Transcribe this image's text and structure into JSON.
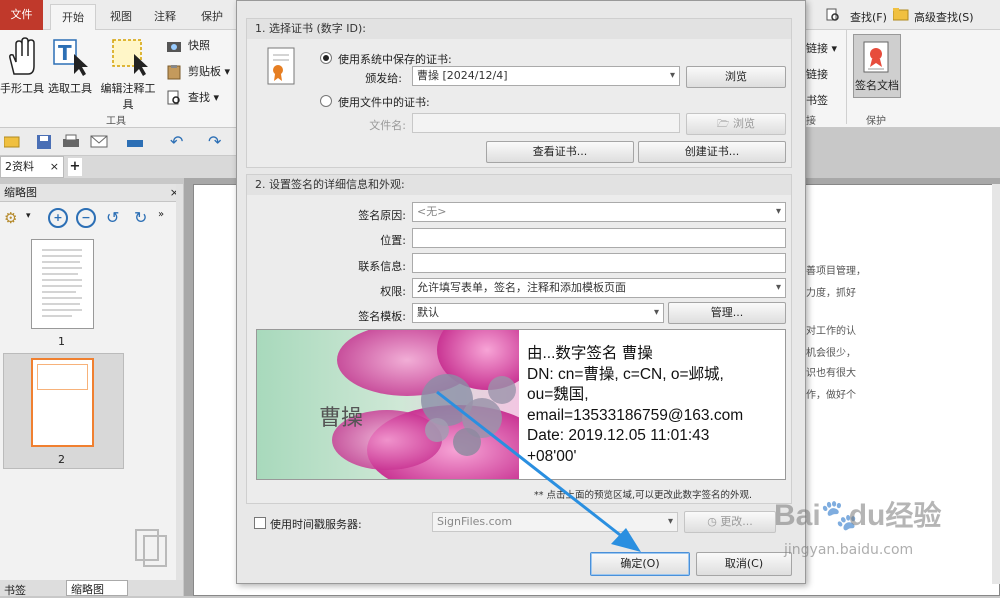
{
  "ribbon": {
    "tabs": [
      "文件",
      "开始",
      "视图",
      "注释",
      "保护"
    ],
    "right_search": "查找(F)",
    "right_advanced_search": "高级查找(S)",
    "big_buttons": [
      "手形工具",
      "选取工具",
      "编辑注释工具"
    ],
    "small_buttons": [
      "快照",
      "剪贴板",
      "查找"
    ],
    "group_tools": "工具",
    "right_items": [
      "链接",
      "链接",
      "书签"
    ],
    "sign_doc": "签名文档",
    "group_protect": "保护",
    "group_partial": "接"
  },
  "document_tab": "2资料",
  "left_pane": {
    "title": "缩略图",
    "pages": [
      "1",
      "2"
    ],
    "bottom_tabs": [
      "书签",
      "缩略图"
    ]
  },
  "doc_text": [
    "完善项目管理，",
    "查力度，抓好",
    "是对工作的认",
    "的机会很少，",
    "知识也有很大",
    "工作，做好个"
  ],
  "dialog": {
    "section1": {
      "title": "1. 选择证书 (数字 ID):",
      "radio_system": "使用系统中保存的证书:",
      "issued_to_label": "颁发给:",
      "issued_to_value": "曹操 [2024/12/4]",
      "browse": "浏览",
      "radio_file": "使用文件中的证书:",
      "filename_label": "文件名:",
      "filename_value": "",
      "browse_disabled": "浏览",
      "view_cert": "查看证书...",
      "create_cert": "创建证书..."
    },
    "section2": {
      "title": "2. 设置签名的详细信息和外观:",
      "reason_label": "签名原因:",
      "reason_value": "<无>",
      "location_label": "位置:",
      "location_value": "",
      "contact_label": "联系信息:",
      "contact_value": "",
      "perm_label": "权限:",
      "perm_value": "允许填写表单，签名，注释和添加模板页面",
      "template_label": "签名模板:",
      "template_value": "默认",
      "manage": "管理...",
      "preview_name": "曹操",
      "preview_lines": [
        "由...数字签名 曹操",
        "DN: cn=曹操, c=CN, o=邺城,",
        "ou=魏国,",
        "email=13533186759@163.com",
        "Date: 2019.12.05 11:01:43",
        "+08'00'"
      ],
      "hint": "** 点击上面的预览区域,可以更改此数字签名的外观."
    },
    "timestamp_label": "使用时间戳服务器:",
    "timestamp_value": "SignFiles.com",
    "change": "更改...",
    "ok": "确定(O)",
    "cancel": "取消(C)"
  },
  "watermark": {
    "brand": "Bai",
    "brand2": "du",
    "cn": "经验",
    "url": "jingyan.baidu.com"
  },
  "colors": {
    "file_tab": "#c0392b",
    "arrow": "#2a8fe0",
    "flower": "#d23a9a"
  }
}
